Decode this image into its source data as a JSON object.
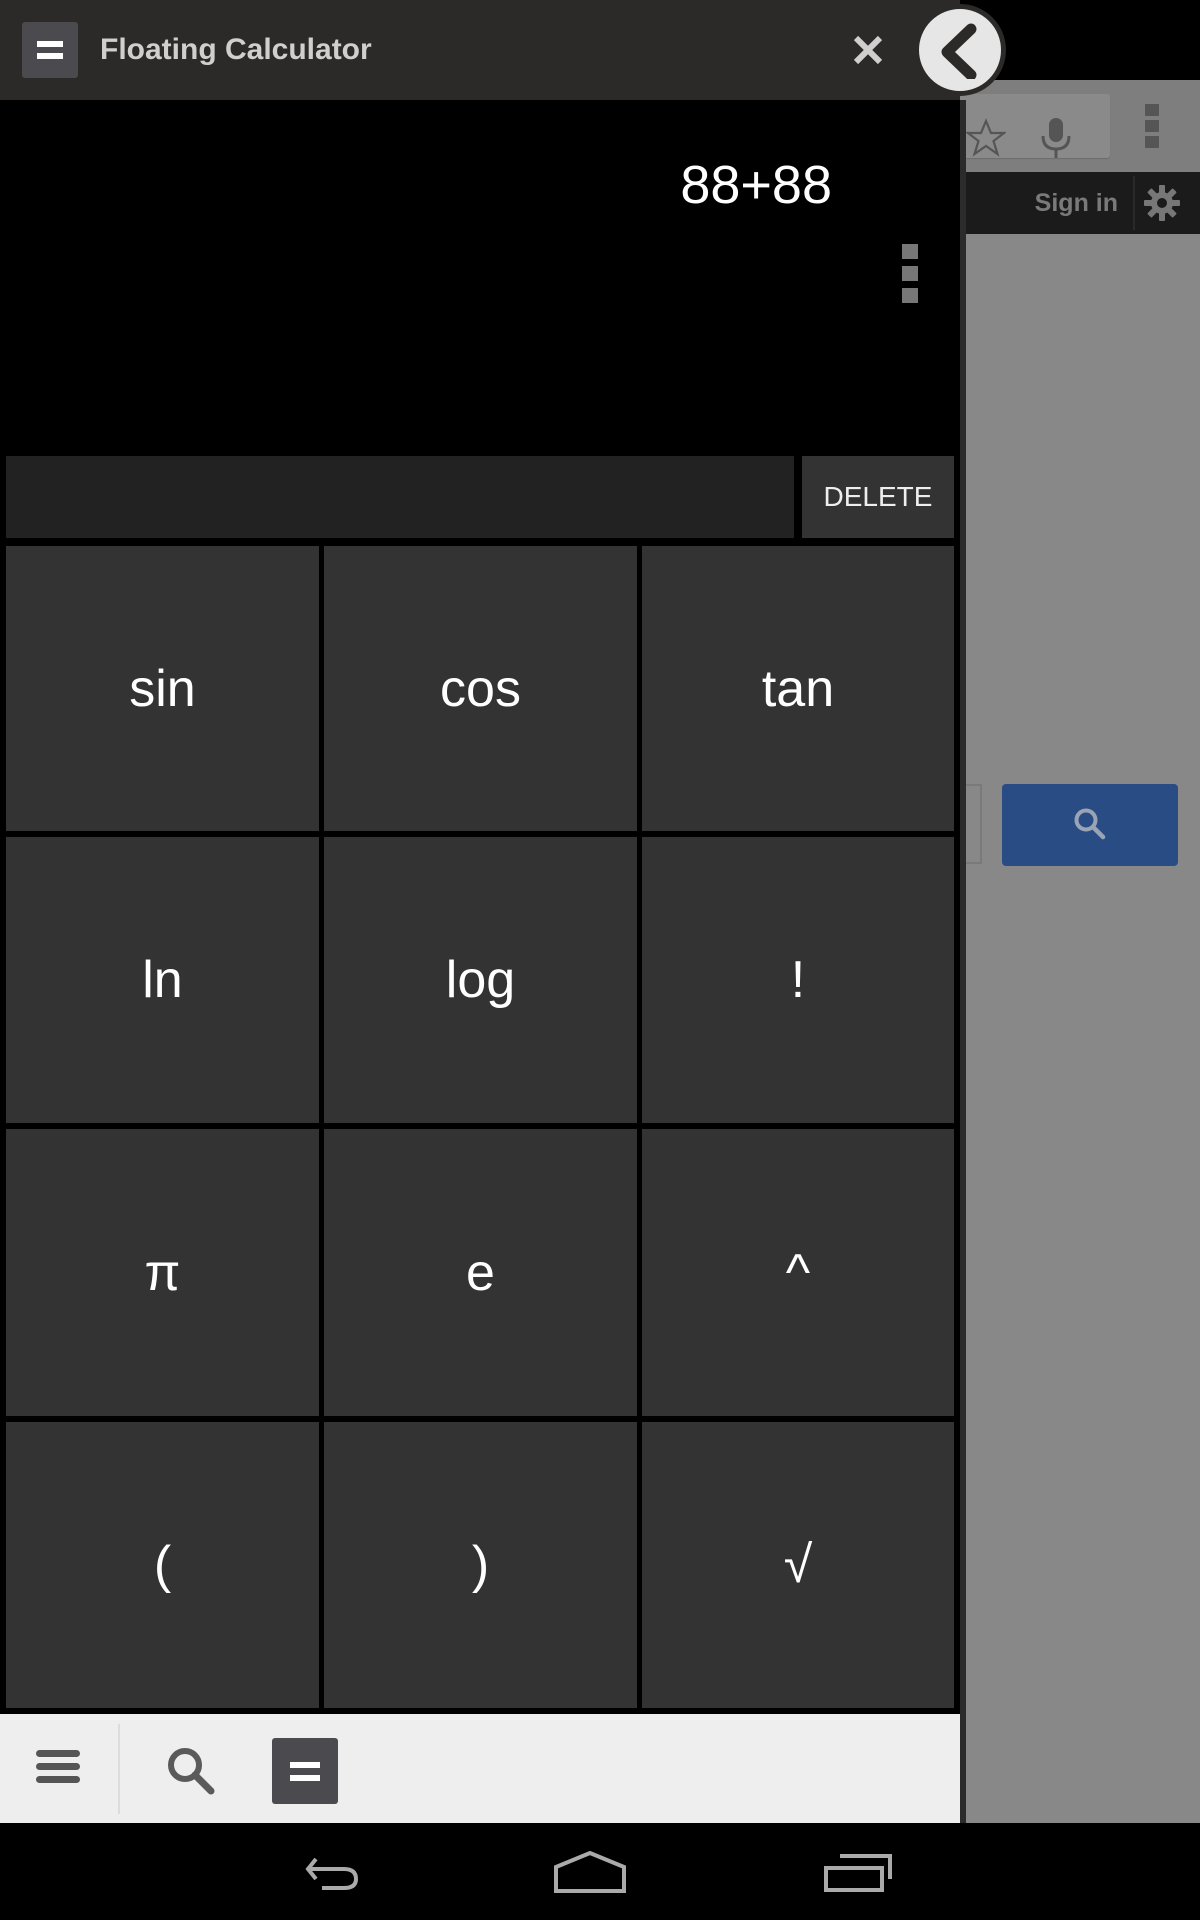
{
  "window": {
    "title": "Floating Calculator",
    "app_icon": "calculator-equals-icon",
    "close_icon": "close-icon",
    "collapse_icon": "chevron-left-icon"
  },
  "display": {
    "expression": "88+88",
    "menu_icon": "overflow-menu-icon"
  },
  "input": {
    "value": "",
    "delete_label": "DELETE"
  },
  "keypad": {
    "keys": [
      "sin",
      "cos",
      "tan",
      "ln",
      "log",
      "!",
      "π",
      "e",
      "^",
      "(",
      ")",
      "√"
    ]
  },
  "toolbar": {
    "items": [
      {
        "icon": "menu-icon"
      },
      {
        "icon": "search-icon"
      },
      {
        "icon": "calculator-icon",
        "active": true
      }
    ]
  },
  "background_browser": {
    "sign_in_label": "Sign in",
    "icons": [
      "star-icon",
      "microphone-icon",
      "overflow-menu-icon",
      "settings-gear-icon",
      "search-icon"
    ],
    "search_button_color": "#2a4c85"
  },
  "navigation_bar": {
    "buttons": [
      "back",
      "home",
      "recent-apps"
    ]
  },
  "colors": {
    "header_bg": "#2b2a29",
    "key_bg": "#333333",
    "display_bg": "#000000",
    "toolbar_bg": "#eeeeee",
    "accent_icon_bg": "#4a4a4f"
  }
}
